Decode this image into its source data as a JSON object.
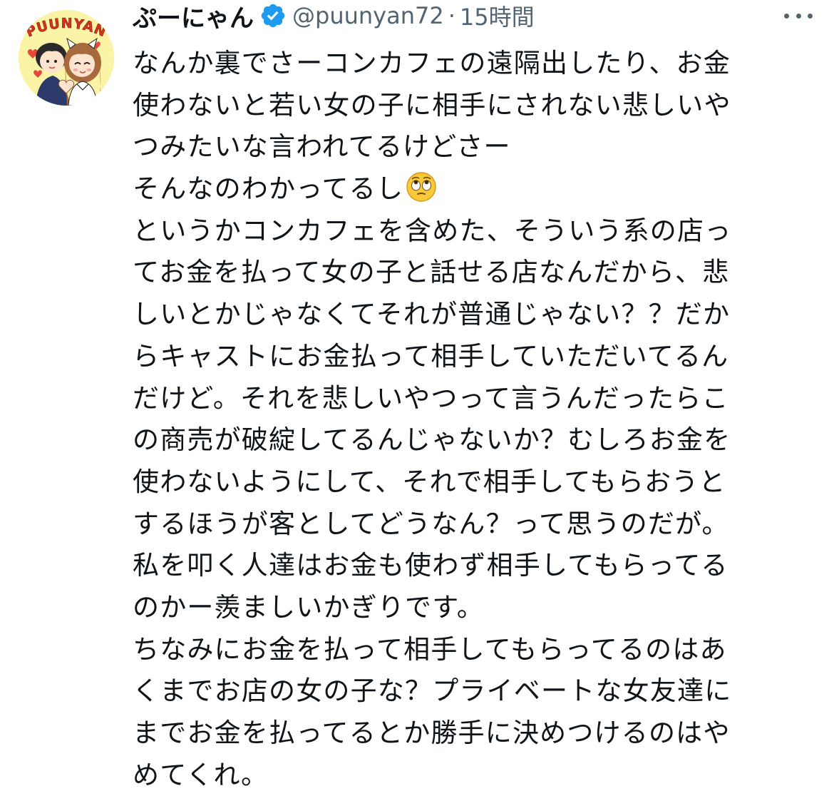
{
  "post": {
    "display_name": "ぷーにゃん",
    "handle": "@puunyan72",
    "separator": "·",
    "time": "15時間",
    "avatar": {
      "text": "PUUNYAN",
      "background": "#fbf3a6",
      "accent": "#d8321e"
    },
    "verified_icon": "verified-badge-icon",
    "more_icon": "more-options-icon",
    "colors": {
      "text": "#0f1419",
      "secondary": "#536471",
      "verified": "#1d9bf0"
    },
    "lines": [
      "なんか裏でさーコンカフェの遠隔出したり、お金",
      "使わないと若い女の子に相手にされない悲しいや",
      "つみたいな言われてるけどさー",
      "そんなのわかってるし",
      "というかコンカフェを含めた、そういう系の店っ",
      "てお金を払って女の子と話せる店なんだから、悲",
      "しいとかじゃなくてそれが普通じゃない？？だか",
      "らキャストにお金払って相手していただいてるん",
      "だけど。それを悲しいやつって言うんだったらこ",
      "の商売が破綻してるんじゃないか？むしろお金を",
      "使わないようにして、それで相手してもらおうと",
      "するほうが客としてどうなん？って思うのだが。",
      "私を叩く人達はお金も使わず相手してもらってる",
      "のかー羨ましいかぎりです。",
      "ちなみにお金を払って相手してもらってるのはあ",
      "くまでお店の女の子な？プライベートな女友達に",
      "までお金を払ってるとか勝手に決めつけるのはや",
      "めてくれ。"
    ],
    "emoji_name": "face-with-rolling-eyes-emoji"
  }
}
